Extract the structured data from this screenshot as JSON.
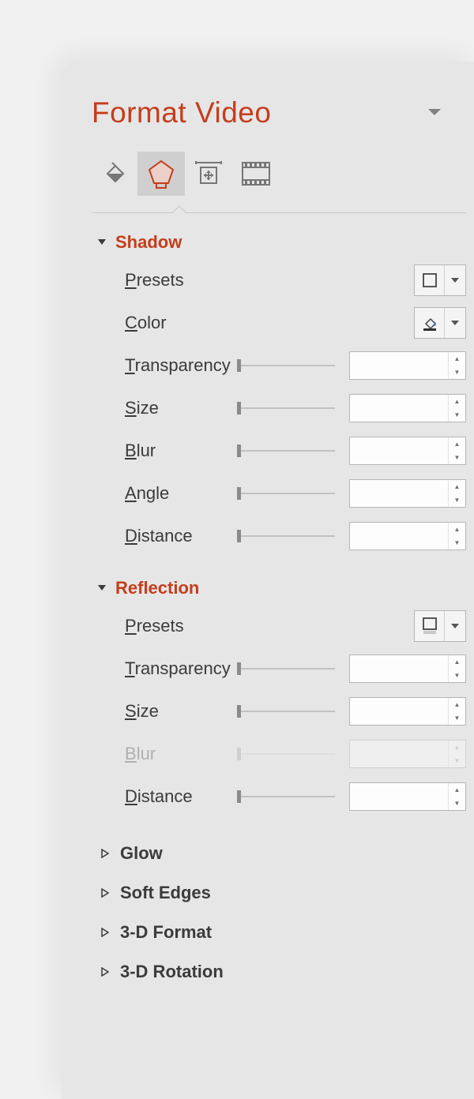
{
  "pane": {
    "title": "Format Video"
  },
  "tabs": {
    "fill": "fill-line-icon",
    "effects": "effects-icon",
    "size": "size-properties-icon",
    "video": "video-icon"
  },
  "shadow": {
    "title": "Shadow",
    "presets_label": "Presets",
    "color_label": "Color",
    "transparency_label": "Transparency",
    "size_label": "Size",
    "blur_label": "Blur",
    "angle_label": "Angle",
    "distance_label": "Distance",
    "values": {
      "transparency": "",
      "size": "",
      "blur": "",
      "angle": "",
      "distance": ""
    }
  },
  "reflection": {
    "title": "Reflection",
    "presets_label": "Presets",
    "transparency_label": "Transparency",
    "size_label": "Size",
    "blur_label": "Blur",
    "distance_label": "Distance",
    "values": {
      "transparency": "",
      "size": "",
      "blur": "",
      "distance": ""
    }
  },
  "collapsed_sections": {
    "glow": "Glow",
    "soft_edges": "Soft Edges",
    "format_3d": "3-D Format",
    "rotation_3d": "3-D Rotation"
  }
}
